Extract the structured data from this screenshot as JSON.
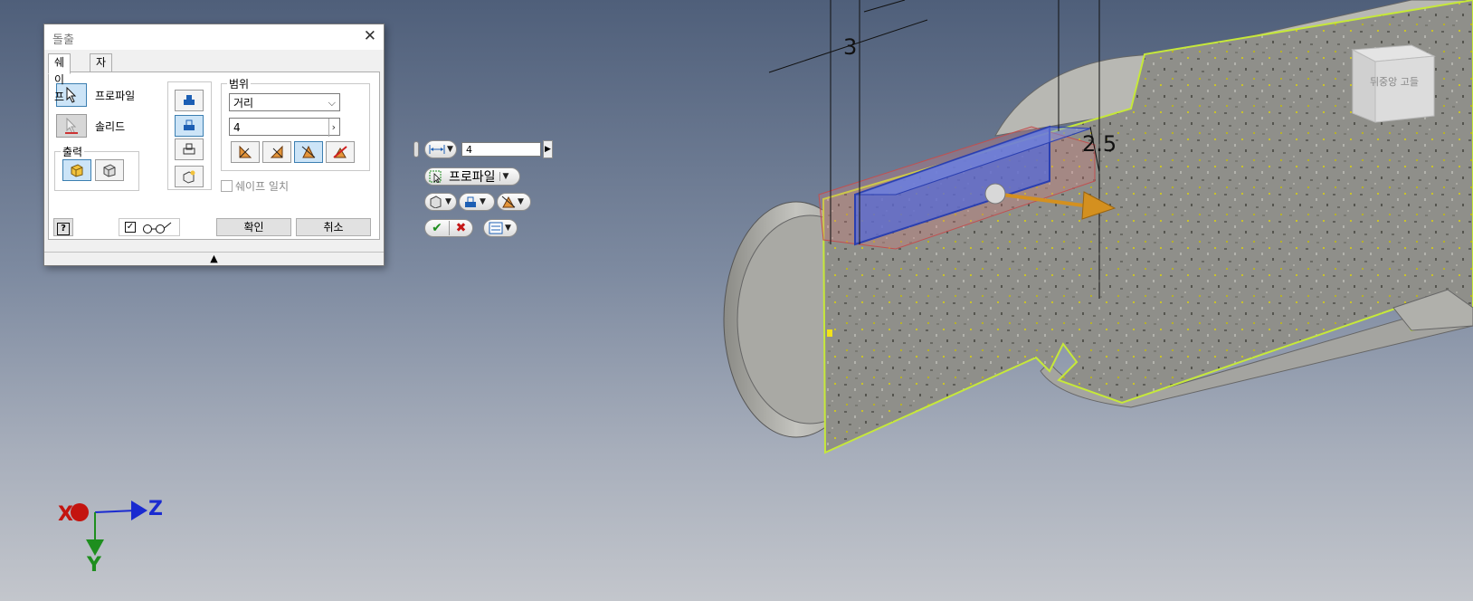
{
  "dialog": {
    "title": "돌출",
    "close_symbol": "✕",
    "tabs": [
      {
        "label": "쉐이프",
        "active": true
      },
      {
        "label": "자세히",
        "active": false
      }
    ],
    "profile_label": "프로파일",
    "solid_label": "솔리드",
    "output_group": "출력",
    "extents_group": "범위",
    "extents_type": "거리",
    "distance_value": "4",
    "match_shape_label": "쉐이프 일치",
    "ok_label": "확인",
    "cancel_label": "취소",
    "help_symbol": "?",
    "grip_symbol": "▲"
  },
  "mini_toolbar": {
    "distance_value": "4",
    "profile_label": "프로파일"
  },
  "viewport": {
    "dimensions": [
      "3",
      "2.5"
    ],
    "viewcube_text": "뒤중앙 고들",
    "axes": {
      "x": "X",
      "y": "Y",
      "z": "Z"
    },
    "colors": {
      "preview_blue": "#5b6fd6",
      "arrow_orange": "#d4901f",
      "edge_green": "#c6e83a"
    }
  }
}
